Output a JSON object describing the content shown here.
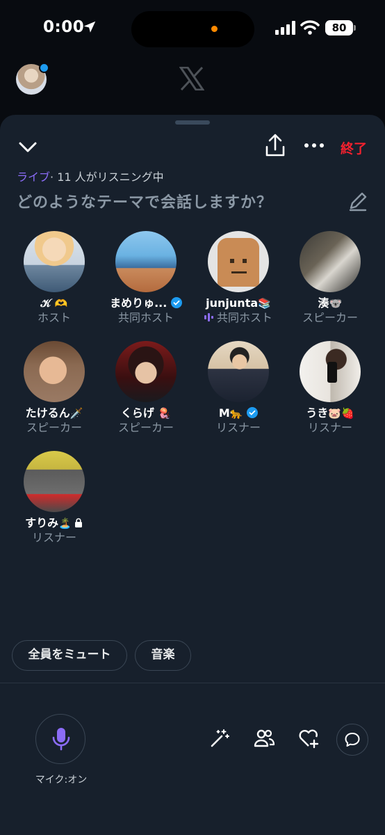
{
  "status_bar": {
    "time": "0:00",
    "battery": "80"
  },
  "sheet": {
    "end_label": "終了",
    "live_label": "ライブ",
    "listening_text": "· 11 人がリスニング中",
    "topic": "どのようなテーマで会話しますか？"
  },
  "participants": [
    {
      "name": "𝒦",
      "emoji": "🫶",
      "role": "ホスト"
    },
    {
      "name": "まめりゅ...",
      "verified": true,
      "role": "共同ホスト"
    },
    {
      "name": "junjunta",
      "emoji": "📚",
      "role": "共同ホスト",
      "speaking": true
    },
    {
      "name": "湊",
      "emoji": "🐨",
      "role": "スピーカー"
    },
    {
      "name": "たけるん",
      "emoji": "🗡️",
      "role": "スピーカー"
    },
    {
      "name": "くらげ",
      "emoji": "🪼",
      "role": "スピーカー"
    },
    {
      "name": "M",
      "emoji": "🐆",
      "verified": true,
      "role": "リスナー"
    },
    {
      "name": "うき",
      "emoji": "🐷🍓",
      "role": "リスナー"
    },
    {
      "name": "すりみ",
      "emoji": "🏝️",
      "locked": true,
      "role": "リスナー"
    }
  ],
  "controls": {
    "mute_all": "全員をミュート",
    "music": "音楽",
    "mic_label": "マイク:オン"
  },
  "colors": {
    "accent_purple": "#8b6cf7",
    "end_red": "#f4212e",
    "verified_blue": "#1d9bf0"
  }
}
